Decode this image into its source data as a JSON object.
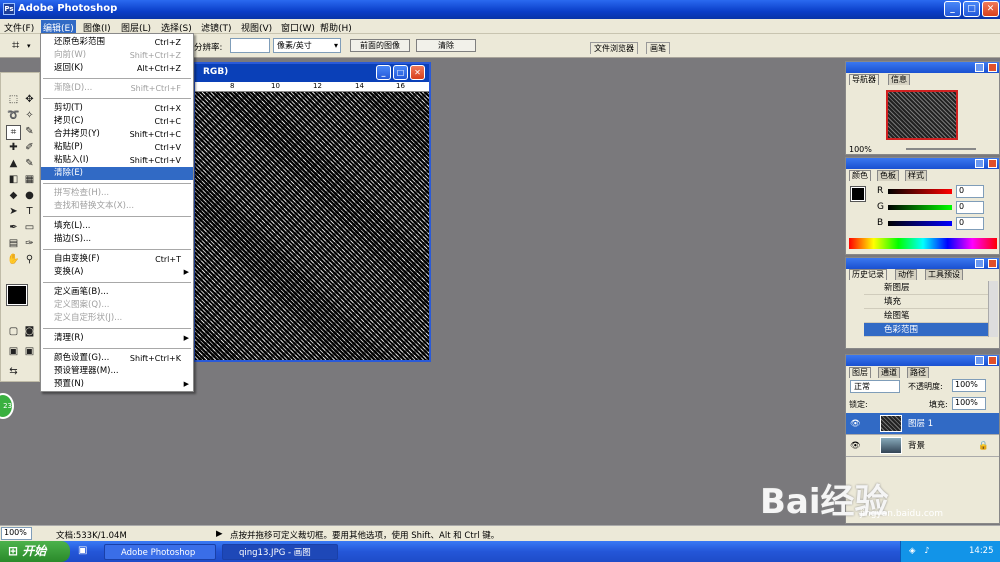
{
  "app": {
    "title": "Adobe Photoshop"
  },
  "menubar": [
    "文件(F)",
    "编辑(E)",
    "图像(I)",
    "图层(L)",
    "选择(S)",
    "滤镜(T)",
    "视图(V)",
    "窗口(W)",
    "帮助(H)"
  ],
  "options": {
    "resolution_label": "分辨率:",
    "unit": "像素/英寸",
    "front_image_button": "前面的图像",
    "clear_button": "清除",
    "tab_file_browser": "文件浏览器",
    "tab_brushes": "画笔"
  },
  "document": {
    "title": "RGB)",
    "ruler": [
      "8",
      "10",
      "12",
      "14",
      "16"
    ]
  },
  "edit_menu": [
    {
      "label": "还原色彩范围",
      "shortcut": "Ctrl+Z",
      "state": "enabled"
    },
    {
      "label": "向前(W)",
      "shortcut": "Shift+Ctrl+Z",
      "state": "disabled"
    },
    {
      "label": "返回(K)",
      "shortcut": "Alt+Ctrl+Z",
      "state": "enabled"
    },
    {
      "label": "渐隐(D)...",
      "shortcut": "Shift+Ctrl+F",
      "state": "disabled"
    },
    {
      "label": "剪切(T)",
      "shortcut": "Ctrl+X",
      "state": "enabled"
    },
    {
      "label": "拷贝(C)",
      "shortcut": "Ctrl+C",
      "state": "enabled"
    },
    {
      "label": "合并拷贝(Y)",
      "shortcut": "Shift+Ctrl+C",
      "state": "enabled"
    },
    {
      "label": "粘贴(P)",
      "shortcut": "Ctrl+V",
      "state": "enabled"
    },
    {
      "label": "粘贴入(I)",
      "shortcut": "Shift+Ctrl+V",
      "state": "enabled"
    },
    {
      "label": "清除(E)",
      "shortcut": "",
      "state": "highlighted"
    },
    {
      "label": "拼写检查(H)...",
      "shortcut": "",
      "state": "disabled"
    },
    {
      "label": "查找和替换文本(X)...",
      "shortcut": "",
      "state": "disabled"
    },
    {
      "label": "填充(L)...",
      "shortcut": "",
      "state": "enabled"
    },
    {
      "label": "描边(S)...",
      "shortcut": "",
      "state": "enabled"
    },
    {
      "label": "自由变换(F)",
      "shortcut": "Ctrl+T",
      "state": "enabled"
    },
    {
      "label": "变换(A)",
      "shortcut": "",
      "state": "submenu"
    },
    {
      "label": "定义画笔(B)...",
      "shortcut": "",
      "state": "enabled"
    },
    {
      "label": "定义图案(Q)...",
      "shortcut": "",
      "state": "disabled"
    },
    {
      "label": "定义自定形状(J)...",
      "shortcut": "",
      "state": "disabled"
    },
    {
      "label": "清理(R)",
      "shortcut": "",
      "state": "submenu"
    },
    {
      "label": "颜色设置(G)...",
      "shortcut": "Shift+Ctrl+K",
      "state": "enabled"
    },
    {
      "label": "预设管理器(M)...",
      "shortcut": "",
      "state": "enabled"
    },
    {
      "label": "预置(N)",
      "shortcut": "",
      "state": "submenu"
    }
  ],
  "navigator": {
    "tabs": [
      "导航器",
      "信息"
    ],
    "zoom": "100%"
  },
  "color": {
    "tabs": [
      "颜色",
      "色板",
      "样式"
    ],
    "r": "0",
    "g": "0",
    "b": "0",
    "labels": [
      "R",
      "G",
      "B"
    ]
  },
  "history": {
    "tabs": [
      "历史记录",
      "动作",
      "工具预设"
    ],
    "items": [
      "新图层",
      "填充",
      "绘图笔",
      "色彩范围"
    ]
  },
  "layers": {
    "tabs": [
      "图层",
      "通道",
      "路径"
    ],
    "blend_mode": "正常",
    "opacity_label": "不透明度:",
    "opacity": "100%",
    "lock_label": "锁定:",
    "fill_label": "填充:",
    "fill": "100%",
    "items": [
      "图层 1",
      "背景"
    ]
  },
  "status": {
    "zoom": "100%",
    "doc_info": "文档:533K/1.04M",
    "hint": "点按并拖移可定义裁切框。要用其他选项，使用 Shift、Alt 和 Ctrl 键。"
  },
  "taskbar": {
    "start": "开始",
    "tasks": [
      "Adobe Photoshop",
      "qing13.JPG - 画图"
    ],
    "time": "14:25"
  },
  "watermark": {
    "brand": "Bai经验",
    "url": "jingyan.baidu.com"
  },
  "colors": {
    "accent": "#316ac5",
    "titlebar": "#0a3ec8",
    "workspace": "#7a797c"
  }
}
